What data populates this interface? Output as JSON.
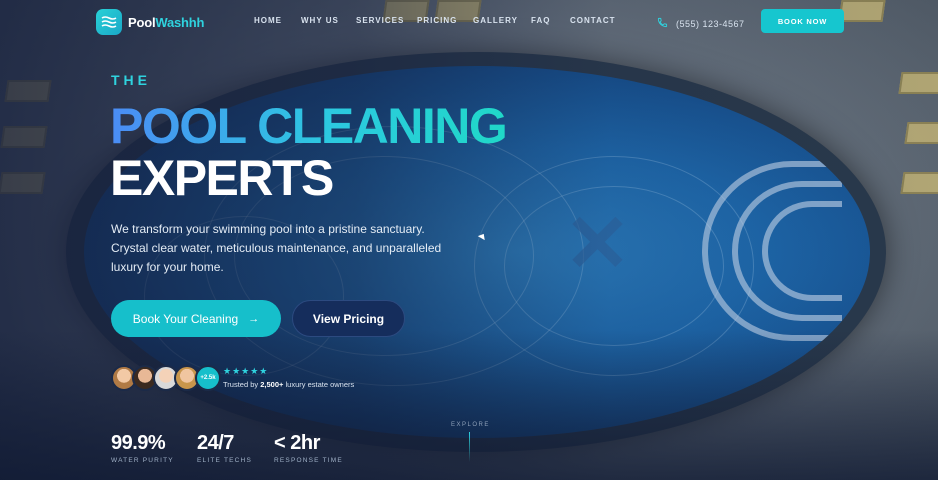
{
  "nav": {
    "logo_prefix": "Pool",
    "logo_suffix": "Washhh",
    "items": [
      "HOME",
      "WHY US",
      "SERVICES",
      "PRICING",
      "GALLERY",
      "FAQ",
      "CONTACT"
    ],
    "phone": "(555) 123-4567",
    "cta": "BOOK NOW"
  },
  "hero": {
    "eyebrow": "THE",
    "title_line1": "POOL CLEANING",
    "title_line2": "EXPERTS",
    "description": "We transform your swimming pool into a pristine sanctuary. Crystal clear water, meticulous maintenance, and unparalleled luxury for your home.",
    "primary_button": "Book Your Cleaning",
    "secondary_button": "View Pricing"
  },
  "social_proof": {
    "avatar_more": "+2.5k",
    "stars": "★★★★★",
    "trust_prefix": "Trusted by ",
    "trust_count": "2,500+",
    "trust_suffix": " luxury estate owners"
  },
  "stats": [
    {
      "value": "99.9%",
      "label": "WATER PURITY"
    },
    {
      "value": "24/7",
      "label": "ELITE TECHS"
    },
    {
      "value": "< 2hr",
      "label": "RESPONSE TIME"
    }
  ],
  "explore": "EXPLORE",
  "colors": {
    "accent": "#16c6cf",
    "navy_button": "#152d5c",
    "gradient_start": "#4b8cf5",
    "gradient_end": "#20d8c8"
  },
  "icons": {
    "logo": "water-waves-icon",
    "phone": "phone-icon",
    "arrow": "arrow-right-icon"
  }
}
